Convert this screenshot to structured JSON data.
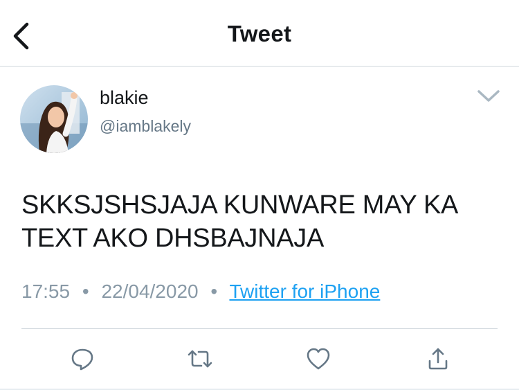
{
  "header": {
    "title": "Tweet",
    "back_icon": "chevron-left-icon"
  },
  "author": {
    "display_name": "blakie",
    "handle": "@iamblakely",
    "avatar": "avatar"
  },
  "tweet": {
    "text": "SKKSJSHSJAJA KUNWARE MAY KA TEXT AKO DHSBAJNAJA",
    "time": "17:55",
    "date": "22/04/2020",
    "separator": "•",
    "source": "Twitter for iPhone",
    "more_icon": "chevron-down-icon"
  },
  "actions": [
    {
      "name": "reply",
      "icon": "reply-icon"
    },
    {
      "name": "retweet",
      "icon": "retweet-icon"
    },
    {
      "name": "like",
      "icon": "heart-icon"
    },
    {
      "name": "share",
      "icon": "share-icon"
    }
  ],
  "colors": {
    "text": "#14171a",
    "secondary": "#657786",
    "meta": "#8899a6",
    "link": "#1da1f2",
    "border": "#cfd6dc"
  }
}
